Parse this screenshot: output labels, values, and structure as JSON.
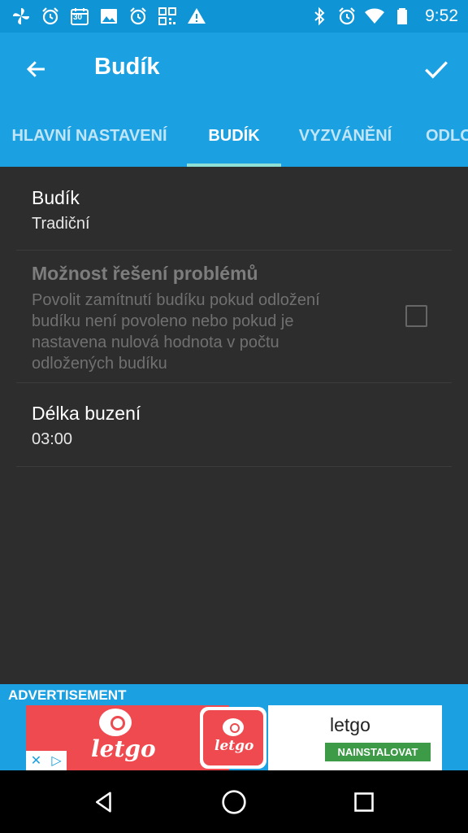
{
  "status_bar": {
    "time": "9:52",
    "left_icons": [
      "pinwheel-icon",
      "alarm-clock-icon",
      "calendar-icon",
      "image-icon",
      "alarm-clock-icon",
      "qr-code-icon",
      "warning-icon"
    ],
    "calendar_number": "30",
    "right_icons": [
      "bluetooth-icon",
      "alarm-clock-icon",
      "wifi-icon",
      "battery-icon"
    ]
  },
  "app_bar": {
    "title": "Budík"
  },
  "tabs": [
    {
      "label": "HLAVNÍ NASTAVENÍ",
      "active": false
    },
    {
      "label": "BUDÍK",
      "active": true
    },
    {
      "label": "VYZVÁNĚNÍ",
      "active": false
    },
    {
      "label": "ODLO",
      "active": false
    }
  ],
  "preferences": [
    {
      "title": "Budík",
      "summary": "Tradiční",
      "enabled": true
    },
    {
      "title": "Možnost řešení problémů",
      "summary": "Povolit zamítnutí budíku pokud odložení budíku není povoleno nebo pokud je nastavena nulová hodnota v počtu odložených budíku",
      "enabled": false,
      "checked": false
    },
    {
      "title": "Délka buzení",
      "summary": "03:00",
      "enabled": true
    }
  ],
  "advertisement": {
    "label": "ADVERTISEMENT",
    "app_name": "letgo",
    "brand_text": "letgo",
    "install_label": "NAINSTALOVAT"
  },
  "colors": {
    "status_bar": "#0f94d5",
    "app_bar": "#1ba0e2",
    "tab_indicator": "#8ee0d6",
    "background": "#2d2d2d",
    "ad_brand": "#ee4a4f",
    "install_button": "#3d9b47"
  }
}
